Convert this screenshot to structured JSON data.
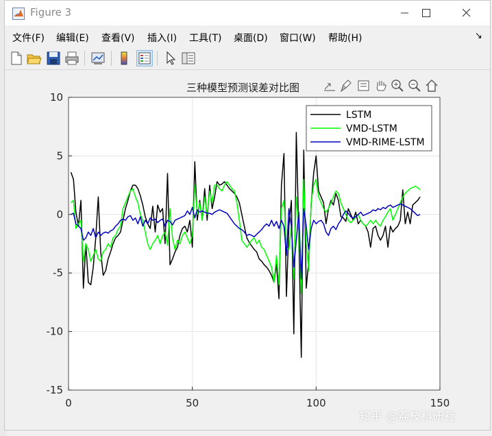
{
  "window": {
    "title": "Figure 3",
    "icon": "matlab-logo-icon"
  },
  "menubar": {
    "items": [
      "文件(F)",
      "编辑(E)",
      "查看(V)",
      "插入(I)",
      "工具(T)",
      "桌面(D)",
      "窗口(W)",
      "帮助(H)"
    ]
  },
  "toolbar": {
    "buttons": [
      "new-figure-icon",
      "open-file-icon",
      "save-icon",
      "print-icon",
      "link-plot-icon",
      "colorbar-icon",
      "legend-icon",
      "edit-plot-cursor-icon",
      "property-inspector-icon"
    ]
  },
  "axes_toolbar": {
    "buttons": [
      "export-icon",
      "brush-icon",
      "data-tips-icon",
      "pan-hand-icon",
      "zoom-in-icon",
      "zoom-out-icon",
      "home-icon"
    ]
  },
  "watermark": "知乎 @荔枝科研社",
  "chart_data": {
    "type": "line",
    "title": "三种模型预测误差对比图",
    "xlabel": "",
    "ylabel": "",
    "xlim": [
      0,
      150
    ],
    "ylim": [
      -15,
      10
    ],
    "xticks": [
      0,
      50,
      100,
      150
    ],
    "yticks": [
      10,
      5,
      0,
      -5,
      -10,
      -15
    ],
    "grid": true,
    "legend_position": "top-right",
    "series": [
      {
        "name": "LSTM",
        "color": "#000000",
        "x": [
          1,
          2,
          3,
          4,
          5,
          6,
          7,
          8,
          9,
          10,
          11,
          12,
          13,
          14,
          15,
          16,
          17,
          18,
          19,
          20,
          21,
          22,
          23,
          24,
          25,
          26,
          27,
          28,
          29,
          30,
          31,
          32,
          33,
          34,
          35,
          36,
          37,
          38,
          39,
          40,
          41,
          42,
          43,
          44,
          45,
          46,
          47,
          48,
          49,
          50,
          51,
          52,
          53,
          54,
          55,
          56,
          57,
          58,
          59,
          60,
          61,
          62,
          63,
          64,
          65,
          66,
          67,
          68,
          69,
          70,
          71,
          72,
          73,
          74,
          75,
          76,
          77,
          78,
          79,
          80,
          81,
          82,
          83,
          84,
          85,
          86,
          87,
          88,
          89,
          90,
          91,
          92,
          93,
          94,
          95,
          96,
          97,
          98,
          99,
          100,
          101,
          102,
          103,
          104,
          105,
          106,
          107,
          108,
          109,
          110,
          111,
          112,
          113,
          114,
          115,
          116,
          117,
          118,
          119,
          120,
          121,
          122,
          123,
          124,
          125,
          126,
          127,
          128,
          129,
          130,
          131,
          132,
          133,
          134,
          135,
          136,
          137,
          138,
          139,
          140,
          141,
          142
        ],
        "y": [
          3.6,
          3.0,
          0.2,
          -1.0,
          1.2,
          -6.3,
          -2.5,
          -5.8,
          -6.0,
          -4.5,
          -2.0,
          1.5,
          -3.2,
          -5.2,
          -4.8,
          -3.8,
          -3.2,
          -2.5,
          -2.0,
          -1.8,
          -1.5,
          -0.5,
          0.5,
          1.2,
          2.0,
          2.5,
          2.5,
          2.2,
          1.6,
          0.8,
          -0.2,
          -0.8,
          -1.2,
          0.7,
          -1.5,
          0.8,
          0.2,
          0.5,
          -2.5,
          3.5,
          -4.3,
          -3.8,
          -3.2,
          -2.8,
          -1.8,
          -1.2,
          -1.0,
          -1.5,
          -0.5,
          -2.8,
          4.5,
          -0.5,
          1.2,
          -0.5,
          2.2,
          -0.5,
          2.5,
          0.5,
          1.5,
          2.8,
          2.5,
          2.6,
          2.8,
          2.5,
          2.2,
          2.0,
          1.8,
          1.5,
          1.0,
          0.0,
          -1.0,
          -2.0,
          -2.4,
          -2.7,
          -3.0,
          -3.2,
          -3.8,
          -4.0,
          -4.3,
          -4.5,
          -4.8,
          -5.2,
          -5.8,
          -4.2,
          -7.2,
          2.5,
          5.2,
          -7.0,
          -1.0,
          1.2,
          -10.2,
          7.0,
          -1.5,
          -12.2,
          5.5,
          -6.3,
          -4.0,
          0.8,
          3.5,
          5.0,
          2.0,
          1.5,
          1.0,
          -0.8,
          0.5,
          1.2,
          0.8,
          1.8,
          1.2,
          -0.2,
          -0.3,
          -0.6,
          0.5,
          0.0,
          -0.5,
          0.2,
          -0.8,
          -0.5,
          -0.8,
          -1.0,
          -1.5,
          -2.8,
          -1.2,
          -1.0,
          -1.8,
          -2.2,
          -1.8,
          -1.0,
          -2.8,
          -1.0,
          -1.5,
          -1.2,
          -1.0,
          -0.5,
          2.1,
          -0.8,
          0.2,
          -0.8,
          0.8,
          1.0,
          1.2,
          1.5
        ]
      },
      {
        "name": "VMD-LSTM",
        "color": "#00ff00",
        "x": [
          1,
          2,
          3,
          4,
          5,
          6,
          7,
          8,
          9,
          10,
          11,
          12,
          13,
          14,
          15,
          16,
          17,
          18,
          19,
          20,
          21,
          22,
          23,
          24,
          25,
          26,
          27,
          28,
          29,
          30,
          31,
          32,
          33,
          34,
          35,
          36,
          37,
          38,
          39,
          40,
          41,
          42,
          43,
          44,
          45,
          46,
          47,
          48,
          49,
          50,
          51,
          52,
          53,
          54,
          55,
          56,
          57,
          58,
          59,
          60,
          61,
          62,
          63,
          64,
          65,
          66,
          67,
          68,
          69,
          70,
          71,
          72,
          73,
          74,
          75,
          76,
          77,
          78,
          79,
          80,
          81,
          82,
          83,
          84,
          85,
          86,
          87,
          88,
          89,
          90,
          91,
          92,
          93,
          94,
          95,
          96,
          97,
          98,
          99,
          100,
          101,
          102,
          103,
          104,
          105,
          106,
          107,
          108,
          109,
          110,
          111,
          112,
          113,
          114,
          115,
          116,
          117,
          118,
          119,
          120,
          121,
          122,
          123,
          124,
          125,
          126,
          127,
          128,
          129,
          130,
          131,
          132,
          133,
          134,
          135,
          136,
          137,
          138,
          139,
          140,
          141,
          142
        ],
        "y": [
          1.0,
          1.2,
          -1.2,
          -0.8,
          -0.5,
          -4.1,
          -2.5,
          -3.0,
          -4.0,
          -3.5,
          -3.0,
          -3.8,
          -4.0,
          -3.2,
          -3.0,
          -2.5,
          -2.8,
          -2.0,
          -1.8,
          -1.3,
          -1.0,
          0.5,
          1.0,
          1.5,
          2.0,
          2.2,
          1.5,
          1.0,
          0.0,
          -0.5,
          -1.5,
          -2.5,
          -3.0,
          -2.5,
          -2.2,
          -1.8,
          -2.5,
          -1.8,
          -1.5,
          -2.6,
          0.5,
          -2.0,
          -3.0,
          -2.2,
          -2.5,
          -1.8,
          -1.5,
          -2.0,
          -2.5,
          -1.8,
          2.5,
          0.0,
          1.0,
          -0.5,
          1.5,
          0.0,
          2.0,
          1.0,
          2.5,
          2.5,
          2.2,
          2.0,
          2.5,
          2.8,
          2.5,
          2.2,
          2.0,
          1.0,
          -0.5,
          -2.2,
          -2.5,
          -2.8,
          -2.5,
          -2.2,
          -2.0,
          -2.5,
          -2.2,
          -2.8,
          -3.0,
          -3.5,
          -4.0,
          -4.5,
          -5.8,
          -3.5,
          -6.0,
          0.5,
          1.2,
          -2.8,
          -3.0,
          -1.0,
          -5.5,
          1.5,
          -1.0,
          -6.8,
          3.0,
          -2.5,
          -4.8,
          1.0,
          2.5,
          3.0,
          1.5,
          1.0,
          0.5,
          0.2,
          0.5,
          1.0,
          1.5,
          2.0,
          1.8,
          1.0,
          0.5,
          0.0,
          -0.5,
          -0.7,
          -0.5,
          -0.2,
          0.0,
          -0.5,
          -0.8,
          -1.0,
          -0.8,
          -0.5,
          -0.8,
          -0.5,
          -0.8,
          -1.0,
          -0.5,
          -0.2,
          0.2,
          0.5,
          -0.5,
          0.0,
          0.5,
          1.0,
          1.5,
          1.8,
          2.0,
          2.2,
          2.3,
          2.4,
          2.3,
          2.1
        ]
      },
      {
        "name": "VMD-RIME-LSTM",
        "color": "#0000bf",
        "x": [
          1,
          2,
          3,
          4,
          5,
          6,
          7,
          8,
          9,
          10,
          11,
          12,
          13,
          14,
          15,
          16,
          17,
          18,
          19,
          20,
          21,
          22,
          23,
          24,
          25,
          26,
          27,
          28,
          29,
          30,
          31,
          32,
          33,
          34,
          35,
          36,
          37,
          38,
          39,
          40,
          41,
          42,
          43,
          44,
          45,
          46,
          47,
          48,
          49,
          50,
          51,
          52,
          53,
          54,
          55,
          56,
          57,
          58,
          59,
          60,
          61,
          62,
          63,
          64,
          65,
          66,
          67,
          68,
          69,
          70,
          71,
          72,
          73,
          74,
          75,
          76,
          77,
          78,
          79,
          80,
          81,
          82,
          83,
          84,
          85,
          86,
          87,
          88,
          89,
          90,
          91,
          92,
          93,
          94,
          95,
          96,
          97,
          98,
          99,
          100,
          101,
          102,
          103,
          104,
          105,
          106,
          107,
          108,
          109,
          110,
          111,
          112,
          113,
          114,
          115,
          116,
          117,
          118,
          119,
          120,
          121,
          122,
          123,
          124,
          125,
          126,
          127,
          128,
          129,
          130,
          131,
          132,
          133,
          134,
          135,
          136,
          137,
          138,
          139,
          140,
          141,
          142
        ],
        "y": [
          0.0,
          0.1,
          -0.8,
          -1.0,
          -1.2,
          -2.2,
          -2.0,
          -1.5,
          -1.8,
          -1.2,
          -2.0,
          -1.5,
          -1.8,
          -1.6,
          -1.5,
          -1.6,
          -1.4,
          -1.3,
          -1.0,
          -0.8,
          -0.5,
          -0.4,
          -0.5,
          -0.2,
          -0.1,
          -0.5,
          -0.3,
          -0.8,
          -0.2,
          -1.0,
          -0.5,
          -0.8,
          -0.3,
          -0.5,
          -0.4,
          -0.7,
          -0.5,
          -0.4,
          -1.0,
          -0.5,
          -0.6,
          -0.9,
          -0.5,
          -0.4,
          -0.3,
          -0.2,
          -0.1,
          0.3,
          0.0,
          0.6,
          -0.3,
          0.4,
          0.2,
          0.3,
          0.2,
          0.1,
          0.1,
          0.0,
          0.2,
          0.3,
          0.4,
          0.3,
          0.2,
          0.1,
          -0.2,
          -0.5,
          -0.8,
          -1.0,
          -1.2,
          -1.3,
          -1.5,
          -1.8,
          -1.7,
          -1.8,
          -1.9,
          -1.7,
          -1.5,
          -1.3,
          -1.0,
          -0.8,
          -1.0,
          -0.5,
          -1.0,
          -0.6,
          -1.2,
          -0.5,
          -1.0,
          -3.5,
          0.5,
          -1.0,
          -4.5,
          -2.2,
          0.2,
          -5.5,
          0.5,
          -1.0,
          -3.0,
          -1.2,
          -0.5,
          -0.8,
          -0.6,
          -0.5,
          -0.8,
          -1.5,
          -1.8,
          -1.2,
          -1.0,
          -1.3,
          -0.8,
          -0.5,
          0.0,
          0.3,
          0.1,
          -0.2,
          -0.3,
          -0.2,
          0.0,
          0.2,
          -0.1,
          0.0,
          0.1,
          0.2,
          0.4,
          0.3,
          0.5,
          0.4,
          0.6,
          0.5,
          0.7,
          0.8,
          0.6,
          0.7,
          0.8,
          0.9,
          0.8,
          0.7,
          0.6,
          0.5,
          0.3,
          0.1,
          -0.1,
          0.0
        ]
      }
    ]
  }
}
